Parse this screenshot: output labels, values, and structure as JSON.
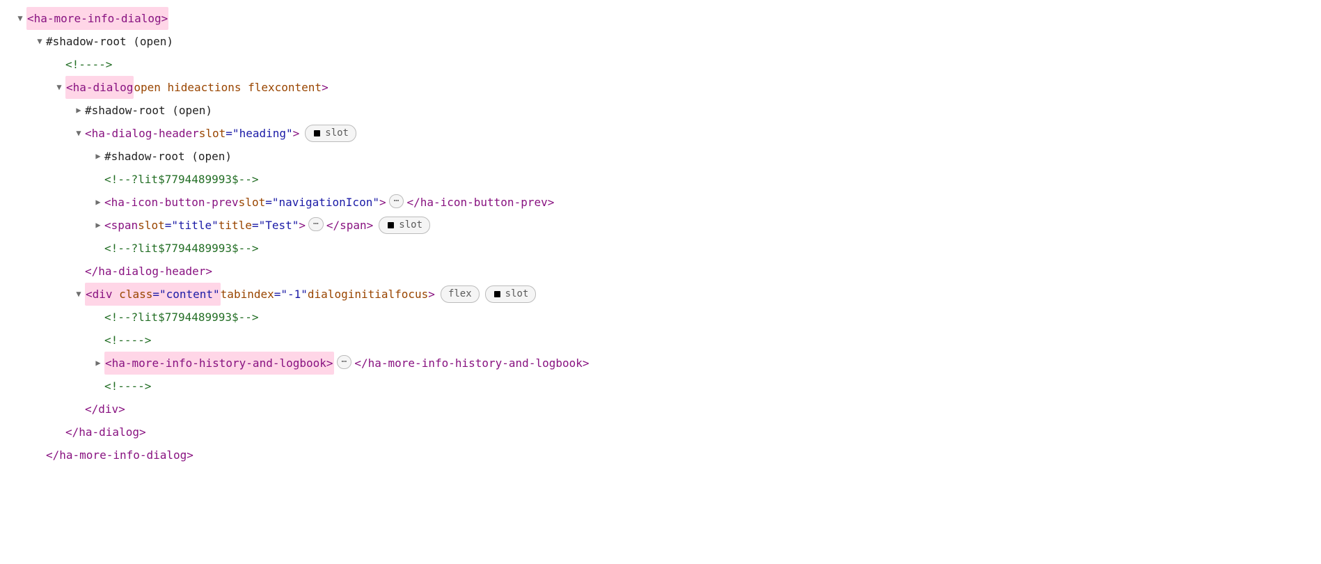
{
  "badges": {
    "slot": "slot",
    "flex": "flex",
    "ellipsis": "⋯"
  },
  "lines": {
    "l1": {
      "open": "<",
      "name": "ha-more-info-dialog",
      "close": ">"
    },
    "l2": {
      "text": "#shadow-root (open)"
    },
    "l3": {
      "text": "<!---->"
    },
    "l4": {
      "open": "<",
      "name": "ha-dialog",
      "attrs": " open hideactions flexcontent",
      "close": ">"
    },
    "l5": {
      "text": "#shadow-root (open)"
    },
    "l6": {
      "open": "<",
      "name": "ha-dialog-header",
      "a1n": " slot",
      "a1v": "=\"heading\"",
      "close": ">"
    },
    "l7": {
      "text": "#shadow-root (open)"
    },
    "l8": {
      "text": "<!--?lit$7794489993$-->"
    },
    "l9": {
      "open": "<",
      "name": "ha-icon-button-prev",
      "a1n": " slot",
      "a1v": "=\"navigationIcon\"",
      "close": ">",
      "closeTag": "</ha-icon-button-prev>"
    },
    "l10": {
      "open": "<",
      "name": "span",
      "a1n": " slot",
      "a1v": "=\"title\"",
      "a2n": " title",
      "a2v": "=\"Test\"",
      "close": ">",
      "closeTag": "</span>"
    },
    "l11": {
      "text": "<!--?lit$7794489993$-->"
    },
    "l12": {
      "text": "</ha-dialog-header>"
    },
    "l13": {
      "open": "<",
      "name": "div",
      "a1n": " class",
      "a1v": "=\"content\"",
      "a2n": " tabindex",
      "a2v": "=\"-1\"",
      "attrs": " dialoginitialfocus",
      "close": ">"
    },
    "l14": {
      "text": "<!--?lit$7794489993$-->"
    },
    "l15": {
      "text": "<!---->"
    },
    "l16": {
      "open": "<",
      "name": "ha-more-info-history-and-logbook",
      "close": ">",
      "closeTag": "</ha-more-info-history-and-logbook>"
    },
    "l17": {
      "text": "<!---->"
    },
    "l18": {
      "text": "</div>"
    },
    "l19": {
      "text": "</ha-dialog>"
    },
    "l20": {
      "text": "</ha-more-info-dialog>"
    }
  }
}
